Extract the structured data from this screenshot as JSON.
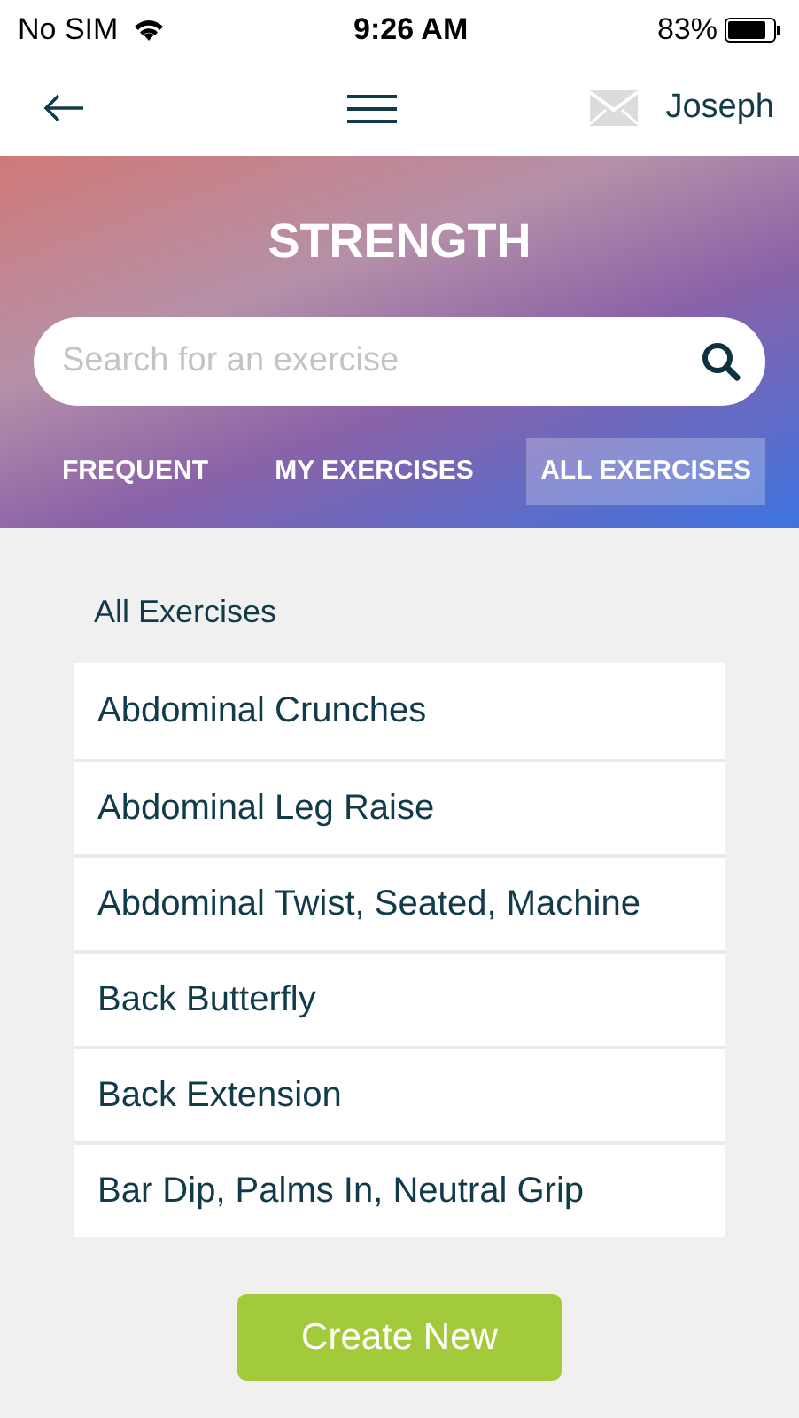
{
  "status_bar": {
    "carrier": "No SIM",
    "time": "9:26 AM",
    "battery": "83%"
  },
  "nav": {
    "user": "Joseph"
  },
  "header": {
    "title": "STRENGTH"
  },
  "search": {
    "placeholder": "Search for an exercise"
  },
  "tabs": [
    {
      "label": "FREQUENT",
      "selected": false
    },
    {
      "label": "MY EXERCISES",
      "selected": false
    },
    {
      "label": "ALL EXERCISES",
      "selected": true
    }
  ],
  "list": {
    "heading": "All Exercises",
    "items": [
      "Abdominal Crunches",
      "Abdominal Leg Raise",
      "Abdominal Twist, Seated, Machine",
      "Back Butterfly",
      "Back Extension",
      "Bar Dip, Palms In, Neutral Grip"
    ]
  },
  "buttons": [
    "Create New"
  ]
}
